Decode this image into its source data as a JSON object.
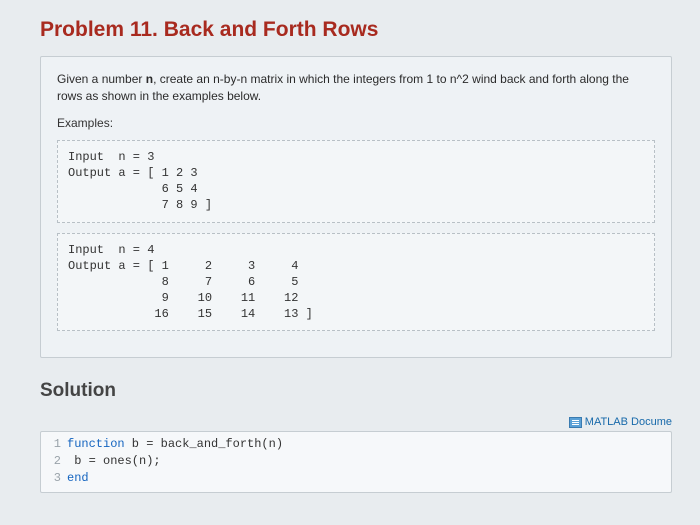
{
  "title": "Problem 11. Back and Forth Rows",
  "description_prefix": "Given a number ",
  "description_bold": "n",
  "description_suffix": ", create an n-by-n matrix in which the integers from 1 to n^2 wind back and forth along the rows as shown in the examples below.",
  "examples_label": "Examples:",
  "example1": "Input  n = 3\nOutput a = [ 1 2 3\n             6 5 4\n             7 8 9 ]",
  "example2": "Input  n = 4\nOutput a = [ 1     2     3     4\n             8     7     6     5\n             9    10    11    12\n            16    15    14    13 ]",
  "solution_header": "Solution",
  "doc_link_label": "MATLAB Docume",
  "code": {
    "ln1": "1",
    "ln2": "2",
    "ln3": "3",
    "kw_function": "function",
    "line1_rest": " b = back_and_forth(n)",
    "line2": "    b = ones(n);",
    "kw_end": "end"
  }
}
